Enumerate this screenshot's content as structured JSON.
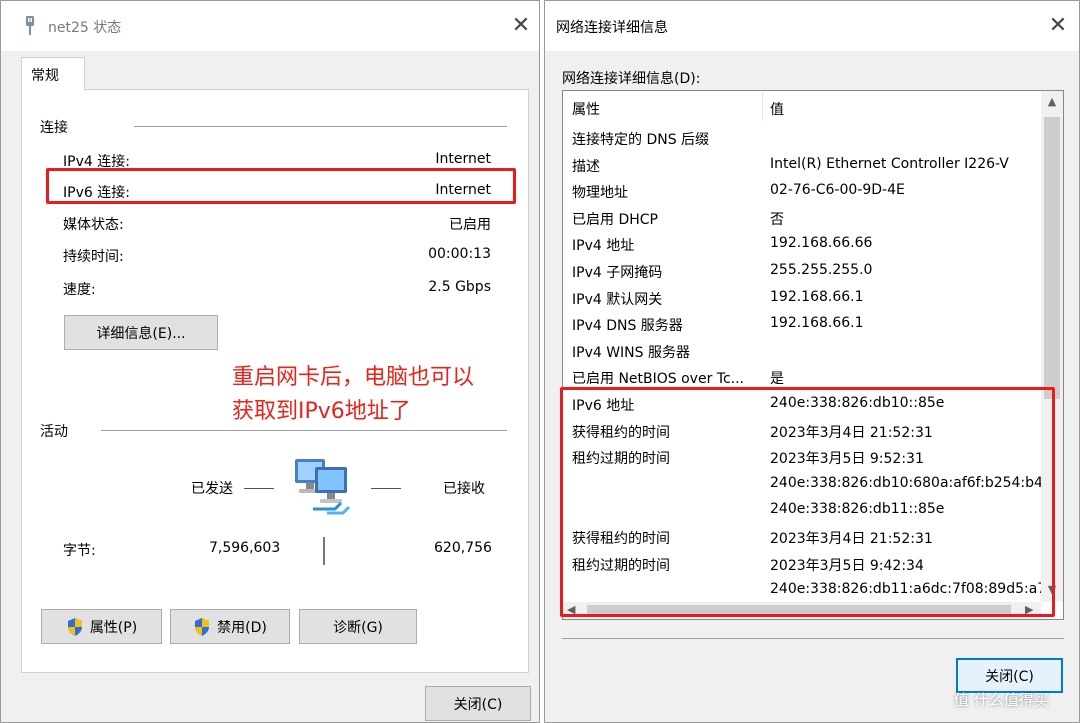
{
  "left_window": {
    "title": "net25 状态",
    "tab": "常规",
    "connection_heading": "连接",
    "rows": [
      {
        "label": "IPv4 连接:",
        "value": "Internet"
      },
      {
        "label": "IPv6 连接:",
        "value": "Internet"
      },
      {
        "label": "媒体状态:",
        "value": "已启用"
      },
      {
        "label": "持续时间:",
        "value": "00:00:13"
      },
      {
        "label": "速度:",
        "value": "2.5 Gbps"
      }
    ],
    "details_button": "详细信息(E)...",
    "annotation_line1": "重启网卡后，电脑也可以",
    "annotation_line2": "获取到IPv6地址了",
    "activity_heading": "活动",
    "sent_label": "已发送",
    "received_label": "已接收",
    "bytes_label": "字节:",
    "bytes_sent": "7,596,603",
    "bytes_received": "620,756",
    "properties_button": "属性(P)",
    "disable_button": "禁用(D)",
    "diagnose_button": "诊断(G)",
    "close_button": "关闭(C)"
  },
  "right_window": {
    "title": "网络连接详细信息",
    "section_label": "网络连接详细信息(D):",
    "col_property": "属性",
    "col_value": "值",
    "rows": [
      {
        "property": "连接特定的 DNS 后缀",
        "value": ""
      },
      {
        "property": "描述",
        "value": "Intel(R) Ethernet Controller I226-V"
      },
      {
        "property": "物理地址",
        "value": "02-76-C6-00-9D-4E"
      },
      {
        "property": "已启用 DHCP",
        "value": "否"
      },
      {
        "property": "IPv4 地址",
        "value": "192.168.66.66"
      },
      {
        "property": "IPv4 子网掩码",
        "value": "255.255.255.0"
      },
      {
        "property": "IPv4 默认网关",
        "value": "192.168.66.1"
      },
      {
        "property": "IPv4 DNS 服务器",
        "value": "192.168.66.1"
      },
      {
        "property": "IPv4 WINS 服务器",
        "value": ""
      },
      {
        "property": "已启用 NetBIOS over Tc...",
        "value": "是"
      },
      {
        "property": "IPv6 地址",
        "value": "240e:338:826:db10::85e"
      },
      {
        "property": "获得租约的时间",
        "value": "2023年3月4日 21:52:31"
      },
      {
        "property": "租约过期的时间",
        "value": "2023年3月5日 9:52:31"
      },
      {
        "property": "",
        "value": "240e:338:826:db10:680a:af6f:b254:b4"
      },
      {
        "property": "",
        "value": "240e:338:826:db11::85e"
      },
      {
        "property": "获得租约的时间",
        "value": "2023年3月4日 21:52:31"
      },
      {
        "property": "租约过期的时间",
        "value": "2023年3月5日 9:42:34"
      },
      {
        "property": "",
        "value": "240e:338:826:db11:a6dc:7f08:89d5:a7"
      }
    ],
    "close_button": "关闭(C)"
  },
  "watermark": "值 什么值得买",
  "colors": {
    "highlight_red": "#e81c1c",
    "annotation_red": "#e8231a",
    "window_bg": "#f0f0f0",
    "button_bg": "#e1e1e1",
    "focus_blue": "#0078d7"
  },
  "icons": [
    "network-adapter-icon",
    "computers-icon",
    "shield-icon",
    "close-icon"
  ]
}
